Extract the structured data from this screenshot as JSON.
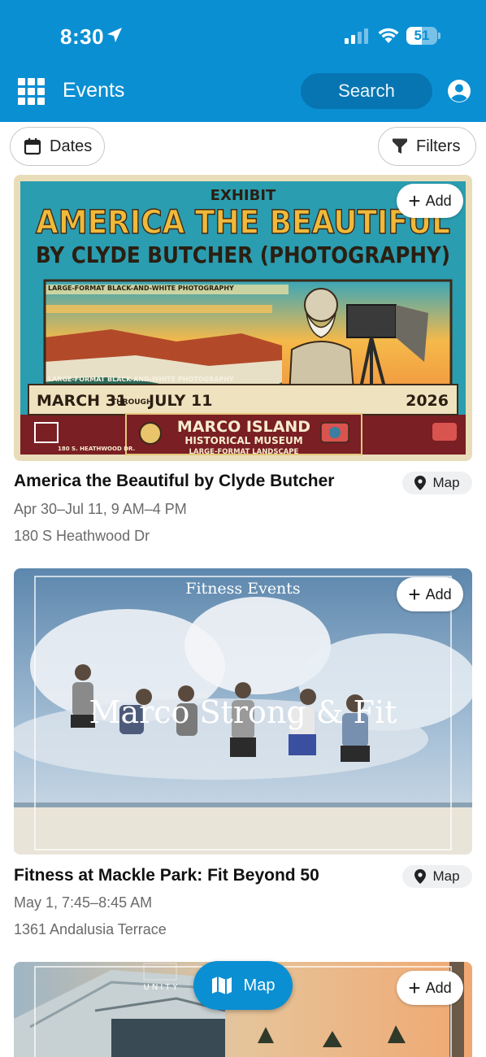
{
  "status_bar": {
    "time": "8:30",
    "battery": "51",
    "battery_level": 0.51
  },
  "header": {
    "title": "Events",
    "search_label": "Search"
  },
  "filters": {
    "dates_label": "Dates",
    "filters_label": "Filters"
  },
  "events": [
    {
      "title": "America the Beautiful by Clyde Butcher",
      "when": "Apr 30–Jul 11, 9 AM–4 PM",
      "where": "180 S Heathwood Dr",
      "add_label": "Add",
      "map_label": "Map",
      "poster": {
        "kicker": "EXHIBIT",
        "headline": "AMERICA THE BEAUTIFUL",
        "subhead": "BY CLYDE BUTCHER (PHOTOGRAPHY)",
        "caption_top": "LARGE-FORMAT BLACK-AND-WHITE PHOTOGRAPHY",
        "caption_bottom": "LARGE-FORMAT BLACK-AND-WHITE PHOTOGRAPHY",
        "date_start": "MARCH 31",
        "through": "THROUGH",
        "date_end": "JULY 11",
        "year": "2026",
        "venue_line1": "MARCO ISLAND",
        "venue_line2": "HISTORICAL MUSEUM",
        "venue_tag": "LARGE-FORMAT LANDSCAPE",
        "address": "180 S. HEATHWOOD DR."
      }
    },
    {
      "title": "Fitness at Mackle Park: Fit Beyond 50",
      "when": "May 1, 7:45–8:45 AM",
      "where": "1361 Andalusia Terrace",
      "add_label": "Add",
      "map_label": "Map",
      "poster": {
        "kicker": "Fitness Events",
        "headline": "Marco Strong & Fit"
      }
    },
    {
      "add_label": "Add",
      "poster": {
        "sign": "UNITY"
      }
    }
  ],
  "fab": {
    "label": "Map"
  },
  "colors": {
    "brand": "#0a8fd3",
    "brand_dark": "#0775b2"
  }
}
